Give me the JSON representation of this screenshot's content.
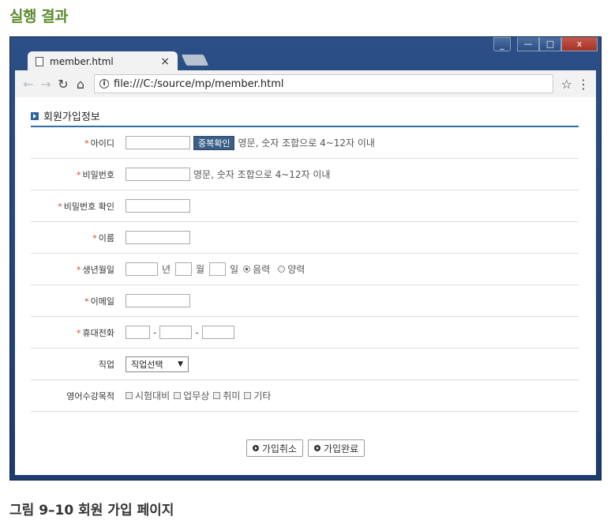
{
  "doc": {
    "heading": "실행 결과",
    "caption": "그림 9–10 회원 가입 페이지"
  },
  "browser": {
    "tab_title": "member.html",
    "tab_close": "×",
    "url": "file:///C:/source/mp/member.html",
    "window_buttons": [
      "_",
      "—",
      "□",
      "x"
    ]
  },
  "form": {
    "section_title": "회원가입정보",
    "required_mark": "*",
    "id": {
      "label": "아이디",
      "check_button": "중복확인",
      "hint": "영문, 숫자 조합으로 4~12자 이내"
    },
    "password": {
      "label": "비밀번호",
      "hint": "영문, 숫자 조합으로 4~12자 이내"
    },
    "password_confirm": {
      "label": "비밀번호 확인"
    },
    "name": {
      "label": "이름"
    },
    "birth": {
      "label": "생년월일",
      "year_unit": "년",
      "month_unit": "월",
      "day_unit": "일",
      "calendar_options": [
        {
          "label": "음력",
          "selected": true
        },
        {
          "label": "양력",
          "selected": false
        }
      ]
    },
    "email": {
      "label": "이메일"
    },
    "phone": {
      "label": "휴대전화",
      "separator": "-"
    },
    "job": {
      "label": "직업",
      "selected": "직업선택",
      "arrow": "▼"
    },
    "english_purpose": {
      "label": "영어수강목적",
      "options": [
        "시험대비",
        "업무상",
        "취미",
        "기타"
      ]
    },
    "actions": {
      "cancel": "가입취소",
      "submit": "가입완료"
    }
  }
}
